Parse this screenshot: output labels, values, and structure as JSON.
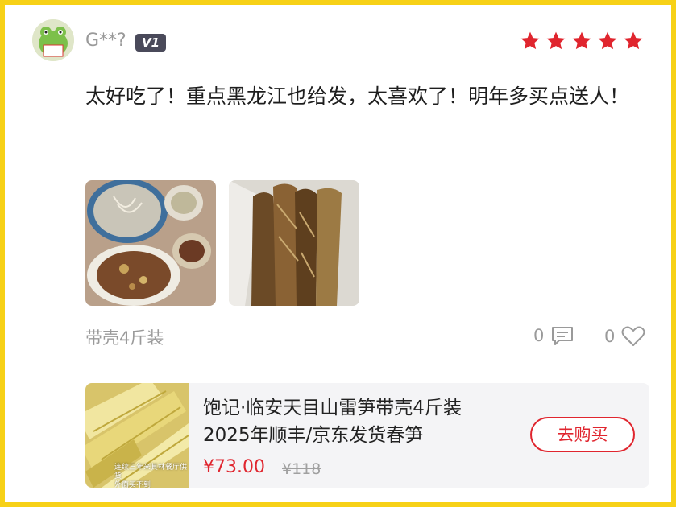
{
  "review": {
    "username": "G**?",
    "level_badge": "V1",
    "rating": 5,
    "text": "太好吃了！重点黑龙江也给发，太喜欢了！明年多买点送人！",
    "variant": "带壳4斤装",
    "comment_count": "0",
    "like_count": "0"
  },
  "product": {
    "title": "饱记·临安天目山雷笋带壳4斤装2025年顺丰/京东发货春笋",
    "price": "¥73.00",
    "original_price": "¥118",
    "buy_label": "去购买",
    "image_caption_line1": "连续三年米其林餐厅供货",
    "image_caption_line2": "外面买不到"
  },
  "colors": {
    "border": "#f7d117",
    "star": "#e0252e",
    "price": "#e0252e",
    "badge_bg": "#4a4a5a"
  },
  "icons": {
    "comment": "comment-icon",
    "like": "heart-icon",
    "star": "star-icon"
  }
}
